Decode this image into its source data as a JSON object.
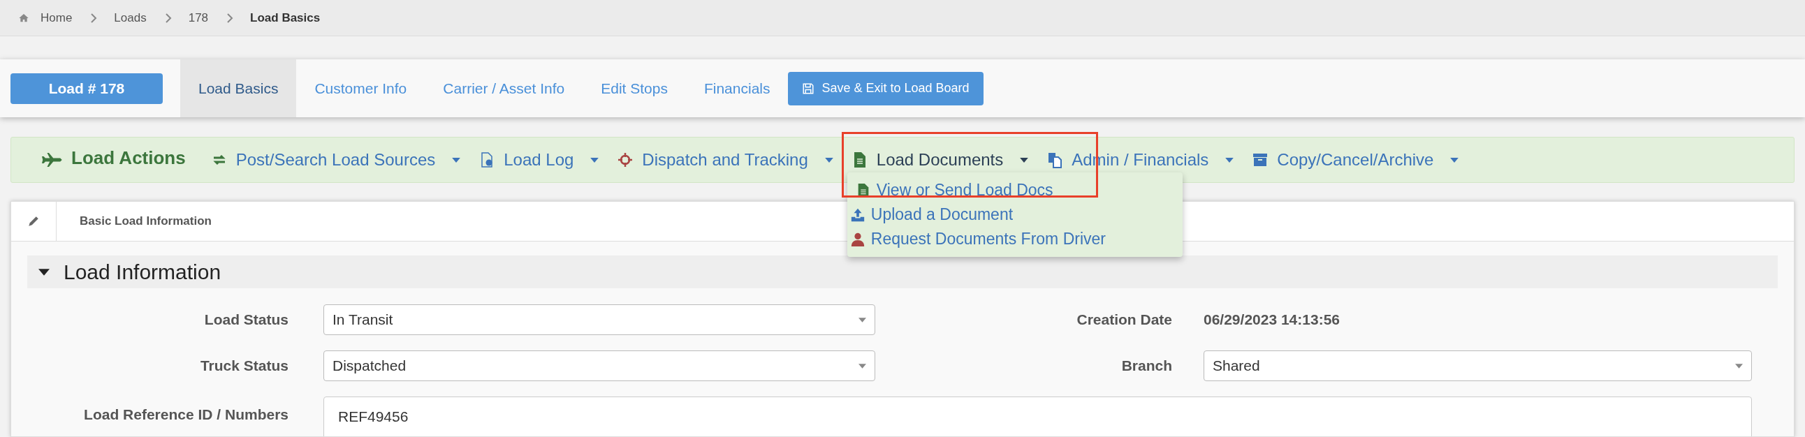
{
  "breadcrumb": [
    {
      "label": "Home",
      "selected": false
    },
    {
      "label": "Loads",
      "selected": false
    },
    {
      "label": "178",
      "selected": false
    },
    {
      "label": "Load Basics",
      "selected": true
    }
  ],
  "load_button": "Load # 178",
  "tabs": [
    {
      "label": "Load Basics",
      "selected": true
    },
    {
      "label": "Customer Info",
      "selected": false
    },
    {
      "label": "Carrier / Asset Info",
      "selected": false
    },
    {
      "label": "Edit Stops",
      "selected": false
    },
    {
      "label": "Financials",
      "selected": false
    }
  ],
  "save_button": "Save & Exit to Load Board",
  "actions": {
    "title": "Load Actions",
    "menus": [
      {
        "label": "Post/Search Load Sources",
        "open": false,
        "highlighted": false
      },
      {
        "label": "Load Log",
        "open": false,
        "highlighted": false
      },
      {
        "label": "Dispatch and Tracking",
        "open": false,
        "highlighted": false
      },
      {
        "label": "Load Documents",
        "open": true,
        "highlighted": true,
        "items": [
          {
            "label": "View or Send Load Docs"
          },
          {
            "label": "Upload a Document"
          },
          {
            "label": "Request Documents From Driver"
          }
        ]
      },
      {
        "label": "Admin / Financials",
        "open": false,
        "highlighted": false
      },
      {
        "label": "Copy/Cancel/Archive",
        "open": false,
        "highlighted": false
      }
    ]
  },
  "panel": {
    "title": "Basic Load Information",
    "section": {
      "title": "Load Information",
      "expanded": true,
      "fields": [
        {
          "label": "Load Status",
          "kind": "select",
          "value": "In Transit"
        },
        {
          "label": "Creation Date",
          "kind": "text",
          "value": "06/29/2023 14:13:56"
        },
        {
          "label": "Truck Status",
          "kind": "select",
          "value": "Dispatched"
        },
        {
          "label": "Branch",
          "kind": "select",
          "value": "Shared"
        },
        {
          "label": "Load Reference ID / Numbers",
          "kind": "textarea",
          "value": "REF49456"
        }
      ]
    }
  }
}
